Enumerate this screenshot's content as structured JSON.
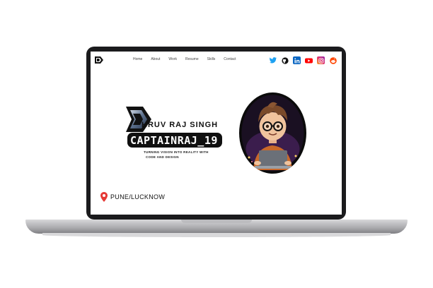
{
  "nav": {
    "items": [
      "Home",
      "About",
      "Work",
      "Resume",
      "Skills",
      "Contact"
    ]
  },
  "hero": {
    "name": "HRUV RAJ SINGH",
    "handle": "CAPTAINRAJ_19",
    "tagline_line1": "TURNING VISION INTO REALITY WITH",
    "tagline_line2": "CODE AND DESIGN"
  },
  "location": {
    "text": "PUNE/LUCKNOW"
  },
  "icons": {
    "socials": [
      "twitter-icon",
      "github-icon",
      "linkedin-icon",
      "youtube-icon",
      "instagram-icon",
      "reddit-icon"
    ]
  },
  "colors": {
    "twitter": "#1da1f2",
    "github": "#111111",
    "linkedin": "#0a66c2",
    "youtube": "#ff0000",
    "instagram": "#e1306c",
    "reddit": "#ff4500",
    "location_pin": "#e53935"
  }
}
